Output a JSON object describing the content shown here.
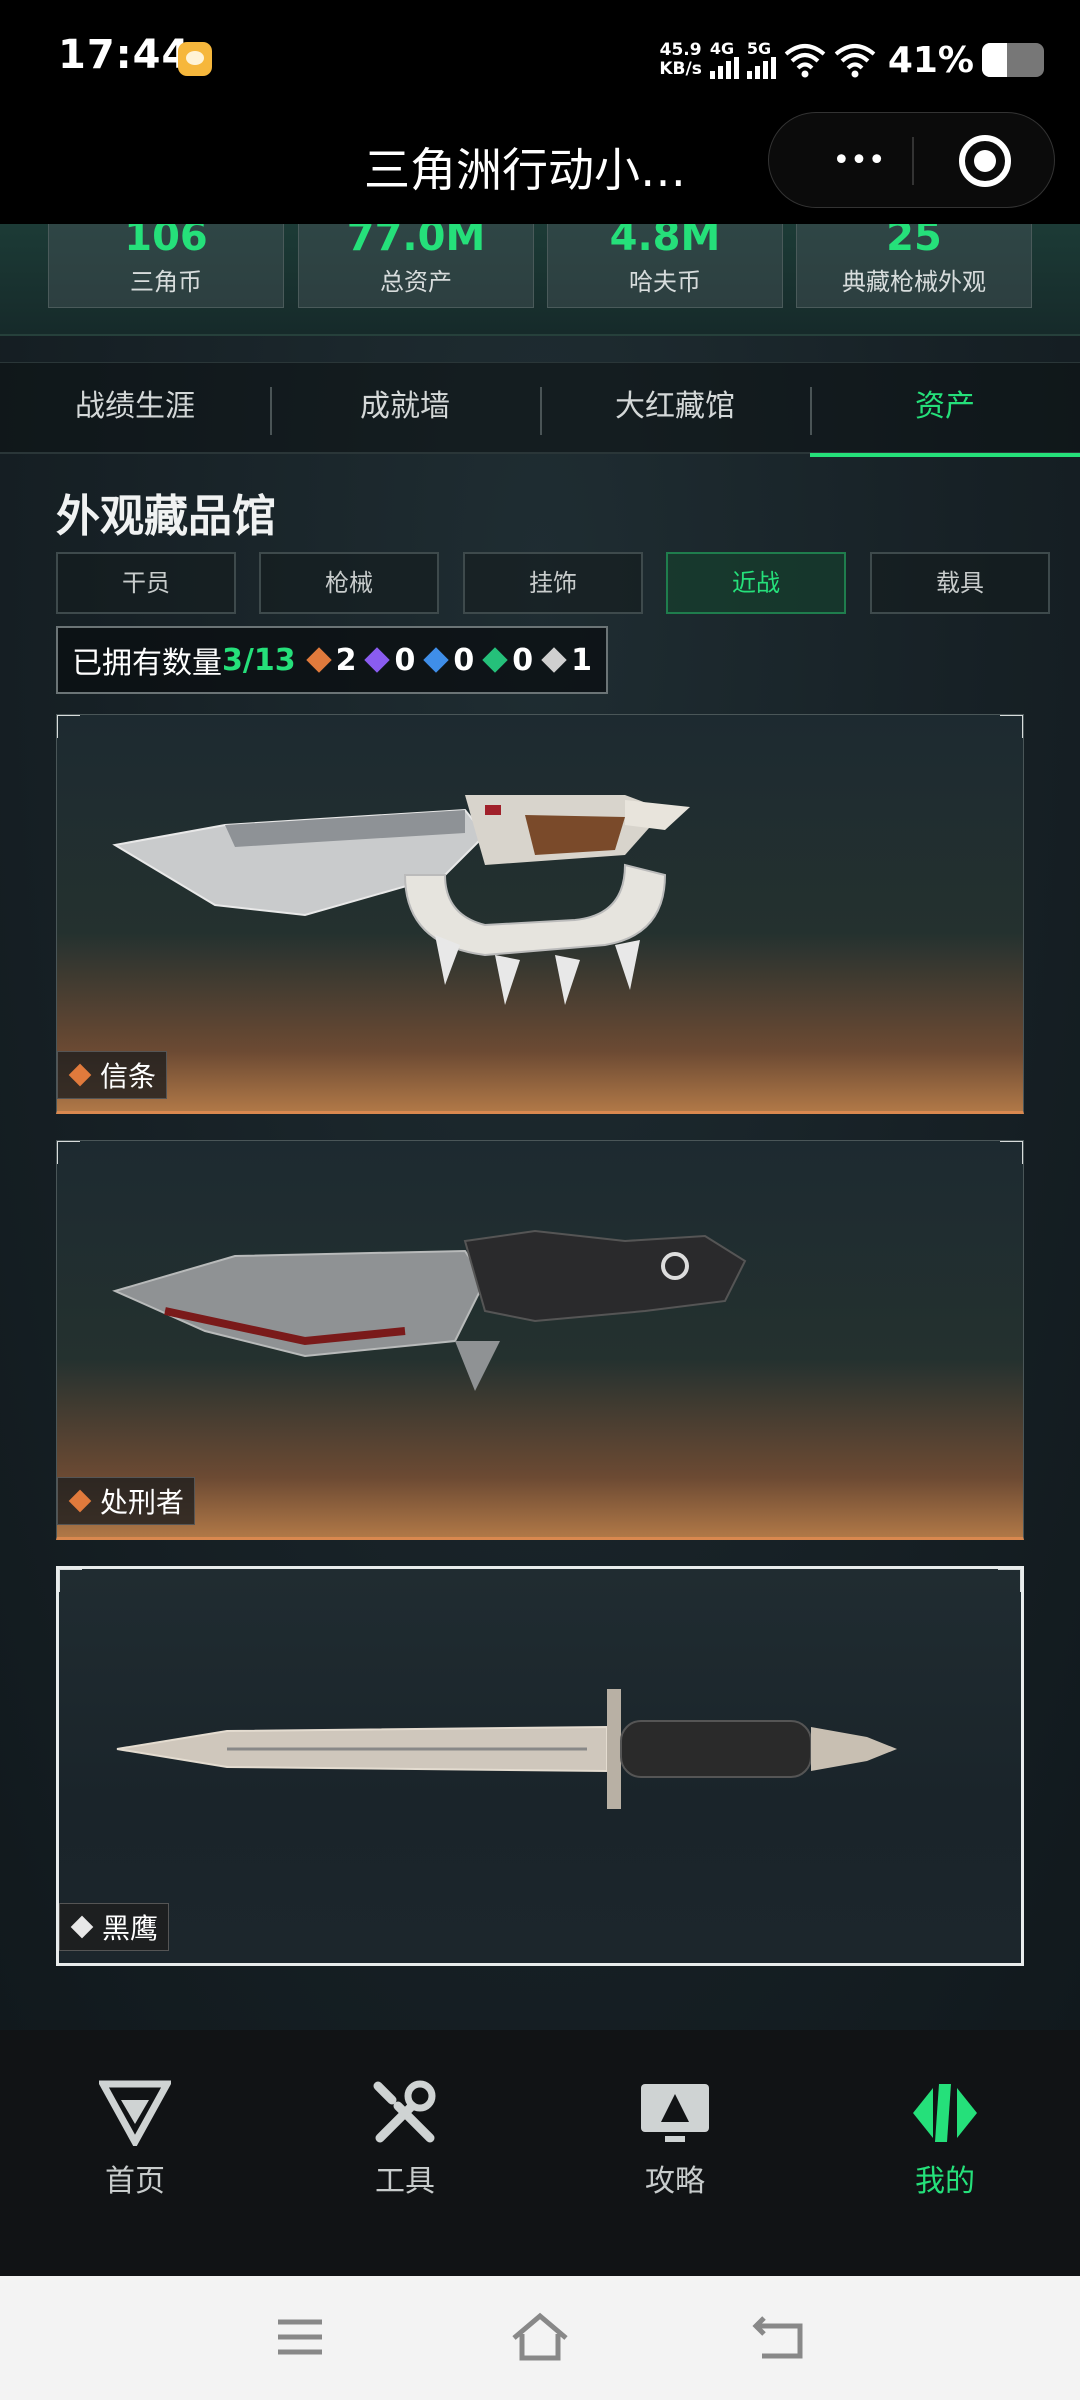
{
  "status_bar": {
    "time": "17:44",
    "net_speed_value": "45.9",
    "net_speed_unit": "KB/s",
    "net_4g": "4G",
    "net_5g": "5G",
    "battery_percent": "41%",
    "battery_level": 0.41,
    "icons": [
      "app-notification-icon",
      "signal-4g-icon",
      "signal-5g-icon",
      "wifi-icon",
      "hotspot-icon",
      "battery-icon"
    ]
  },
  "header": {
    "title": "三角洲行动小…",
    "more_icon": "more-dots-icon",
    "close_icon": "target-close-icon"
  },
  "stats": [
    {
      "value": "106",
      "label": "三角币"
    },
    {
      "value": "77.0M",
      "label": "总资产"
    },
    {
      "value": "4.8M",
      "label": "哈夫币"
    },
    {
      "value": "25",
      "label": "典藏枪械外观"
    }
  ],
  "tabs": [
    {
      "label": "战绩生涯",
      "active": false
    },
    {
      "label": "成就墙",
      "active": false
    },
    {
      "label": "大红藏馆",
      "active": false
    },
    {
      "label": "资产",
      "active": true
    }
  ],
  "section": {
    "title": "外观藏品馆",
    "subtabs": [
      {
        "label": "干员",
        "active": false
      },
      {
        "label": "枪械",
        "active": false
      },
      {
        "label": "挂饰",
        "active": false
      },
      {
        "label": "近战",
        "active": true
      },
      {
        "label": "载具",
        "active": false
      }
    ],
    "owned_label": "已拥有数量",
    "owned_value": "3/13",
    "rarity_counts": [
      {
        "count": "2",
        "color": "#e07a3c"
      },
      {
        "count": "0",
        "color": "#8a5cf0"
      },
      {
        "count": "0",
        "color": "#3f8ee8"
      },
      {
        "count": "0",
        "color": "#25c07a"
      },
      {
        "count": "1",
        "color": "#cfcfcf"
      }
    ]
  },
  "items": [
    {
      "name": "信条",
      "rarity_color": "#e07a3c"
    },
    {
      "name": "处刑者",
      "rarity_color": "#e07a3c"
    },
    {
      "name": "黑鹰",
      "rarity_color": "#e8e8e8"
    }
  ],
  "bottom_nav": [
    {
      "label": "首页",
      "icon": "home-g-logo-icon",
      "active": false
    },
    {
      "label": "工具",
      "icon": "tools-wrench-icon",
      "active": false
    },
    {
      "label": "攻略",
      "icon": "guide-monitor-icon",
      "active": false
    },
    {
      "label": "我的",
      "icon": "profile-logo-icon",
      "active": true
    }
  ],
  "colors": {
    "accent": "#25e07a",
    "gold_rarity": "#e07a3c",
    "background": "#172126"
  }
}
